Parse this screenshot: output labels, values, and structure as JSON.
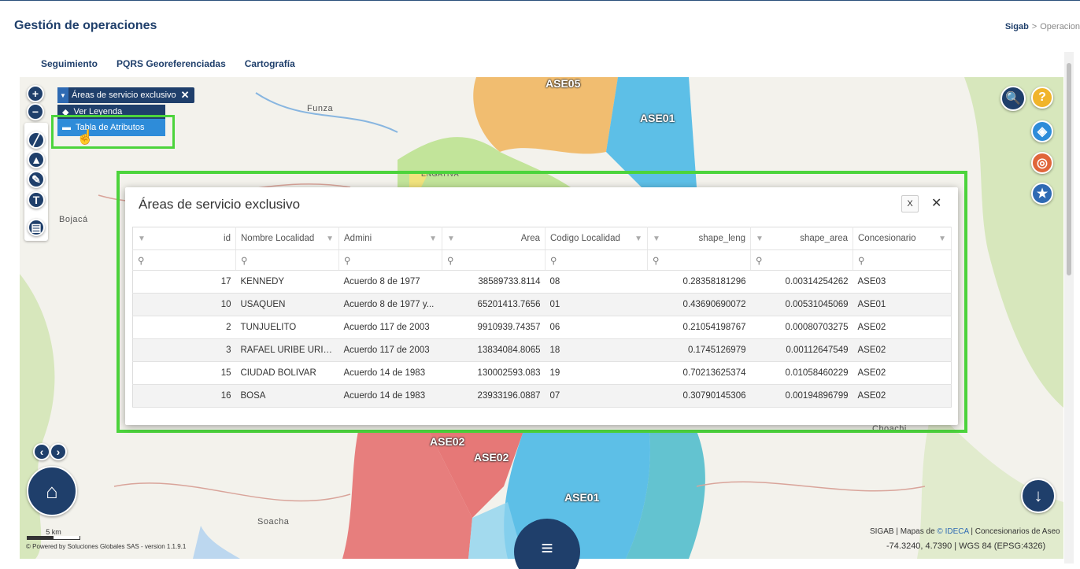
{
  "header": {
    "title": "Gestión de operaciones",
    "breadcrumb": {
      "home": "Sigab",
      "separator": ">",
      "current": "Operacion"
    }
  },
  "tabs": [
    {
      "label": "Seguimiento"
    },
    {
      "label": "PQRS Georeferenciadas"
    },
    {
      "label": "Cartografía"
    }
  ],
  "map": {
    "places": [
      "Funza",
      "Bojacá",
      "Soacha",
      "Choachi",
      "ENGATIVA"
    ],
    "zones": [
      "ASE05",
      "ASE01",
      "ASE02",
      "ASE02",
      "ASE01"
    ],
    "layer_control": {
      "layer_name": "Áreas de servicio exclusivo",
      "menu": [
        "Ver Leyenda",
        "Tabla de Atributos"
      ]
    },
    "scale": "5 km",
    "powered_by": "© Powered by Soluciones Globales SAS - version 1.1.9.1",
    "attribution": {
      "prefix": "SIGAB | Mapas de ",
      "link": "© IDECA",
      "suffix": " | Concesionarios de Aseo"
    },
    "coordinates": "-74.3240, 4.7390 | WGS 84 (EPSG:4326)"
  },
  "dialog": {
    "title": "Áreas de servicio exclusivo",
    "columns": [
      "id",
      "Nombre Localidad",
      "Admini",
      "Area",
      "Codigo Localidad",
      "shape_leng",
      "shape_area",
      "Concesionario"
    ],
    "rows": [
      [
        "17",
        "KENNEDY",
        "Acuerdo 8 de 1977",
        "38589733.8114",
        "08",
        "0.28358181296",
        "0.00314254262",
        "ASE03"
      ],
      [
        "10",
        "USAQUEN",
        "Acuerdo 8 de 1977 y...",
        "65201413.7656",
        "01",
        "0.43690690072",
        "0.00531045069",
        "ASE01"
      ],
      [
        "2",
        "TUNJUELITO",
        "Acuerdo 117 de 2003",
        "9910939.74357",
        "06",
        "0.21054198767",
        "0.00080703275",
        "ASE02"
      ],
      [
        "3",
        "RAFAEL URIBE URIBE",
        "Acuerdo 117 de 2003",
        "13834084.8065",
        "18",
        "0.1745126979",
        "0.00112647549",
        "ASE02"
      ],
      [
        "15",
        "CIUDAD BOLIVAR",
        "Acuerdo 14 de 1983",
        "130002593.083",
        "19",
        "0.70213625374",
        "0.01058460229",
        "ASE02"
      ],
      [
        "16",
        "BOSA",
        "Acuerdo 14 de 1983",
        "23933196.0887",
        "07",
        "0.30790145306",
        "0.00194896799",
        "ASE02"
      ]
    ]
  },
  "colors": {
    "accent": "#1f3f6b",
    "highlight": "#4cd43c",
    "zone_orange": "#f0b45a",
    "zone_blue": "#42b6e6",
    "zone_red": "#e46a6a",
    "zone_green": "#b9e28c",
    "zone_teal": "#3fb6c9"
  }
}
